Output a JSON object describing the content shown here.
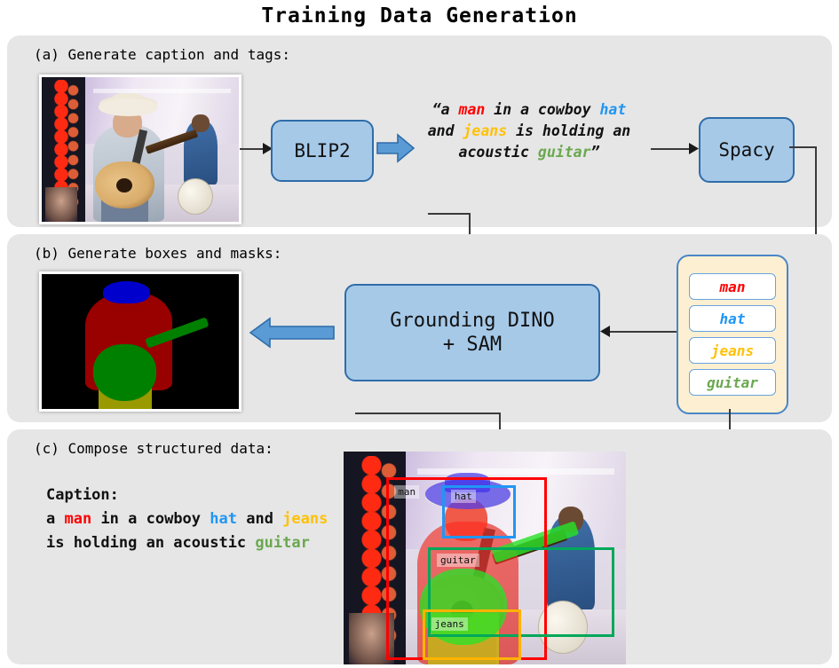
{
  "title": "Training Data Generation",
  "sections": {
    "a": {
      "label": "(a) Generate caption and tags:",
      "model_box": "BLIP2",
      "nlp_box": "Spacy",
      "caption_quoted": "“a man in a cowboy hat and jeans is holding an acoustic guitar”",
      "caption_tokens": [
        {
          "text": "“a ",
          "color": "#111111"
        },
        {
          "text": "man",
          "color": "#ff0000"
        },
        {
          "text": " in a cowboy ",
          "color": "#111111"
        },
        {
          "text": "hat",
          "color": "#2196f3"
        },
        {
          "text": " and ",
          "color": "#111111"
        },
        {
          "text": "jeans",
          "color": "#ffc107"
        },
        {
          "text": " is holding an acoustic ",
          "color": "#111111"
        },
        {
          "text": "guitar",
          "color": "#6aa84f"
        },
        {
          "text": "”",
          "color": "#111111"
        }
      ]
    },
    "b": {
      "label": "(b) Generate boxes and masks:",
      "model_box_line1": "Grounding DINO",
      "model_box_line2": "+ SAM"
    },
    "c": {
      "label": "(c) Compose structured data:",
      "caption_heading": "Caption:",
      "caption_tokens": [
        {
          "text": "a ",
          "color": "#111111"
        },
        {
          "text": "man",
          "color": "#ff0000"
        },
        {
          "text": " in a cowboy ",
          "color": "#111111"
        },
        {
          "text": "hat",
          "color": "#2196f3"
        },
        {
          "text": " and ",
          "color": "#111111"
        },
        {
          "text": "jeans",
          "color": "#ffc107"
        },
        {
          "text": " is holding an acoustic ",
          "color": "#111111"
        },
        {
          "text": "guitar",
          "color": "#6aa84f"
        }
      ]
    }
  },
  "tags": [
    {
      "label": "man",
      "color": "#ff0000"
    },
    {
      "label": "hat",
      "color": "#2196f3"
    },
    {
      "label": "jeans",
      "color": "#ffc107"
    },
    {
      "label": "guitar",
      "color": "#6aa84f"
    }
  ],
  "annotated_boxes": [
    {
      "label": "man",
      "color": "#ff0000"
    },
    {
      "label": "hat",
      "color": "#2196f3"
    },
    {
      "label": "guitar",
      "color": "#00a85a"
    },
    {
      "label": "jeans",
      "color": "#ffb300"
    }
  ],
  "colors": {
    "panel_bg": "#e6e6e6",
    "box_fill": "#a6c9e8",
    "box_border": "#2e6daa",
    "tags_panel_fill": "#fdf0d2",
    "tags_panel_border": "#4a86c8",
    "arrow_fill": "#4a86c8",
    "connector": "#3a3a3a",
    "mask_man": "#990000",
    "mask_hat": "#0000cc",
    "mask_guitar": "#008000",
    "mask_jeans": "#999900",
    "mask_bg": "#000000"
  }
}
